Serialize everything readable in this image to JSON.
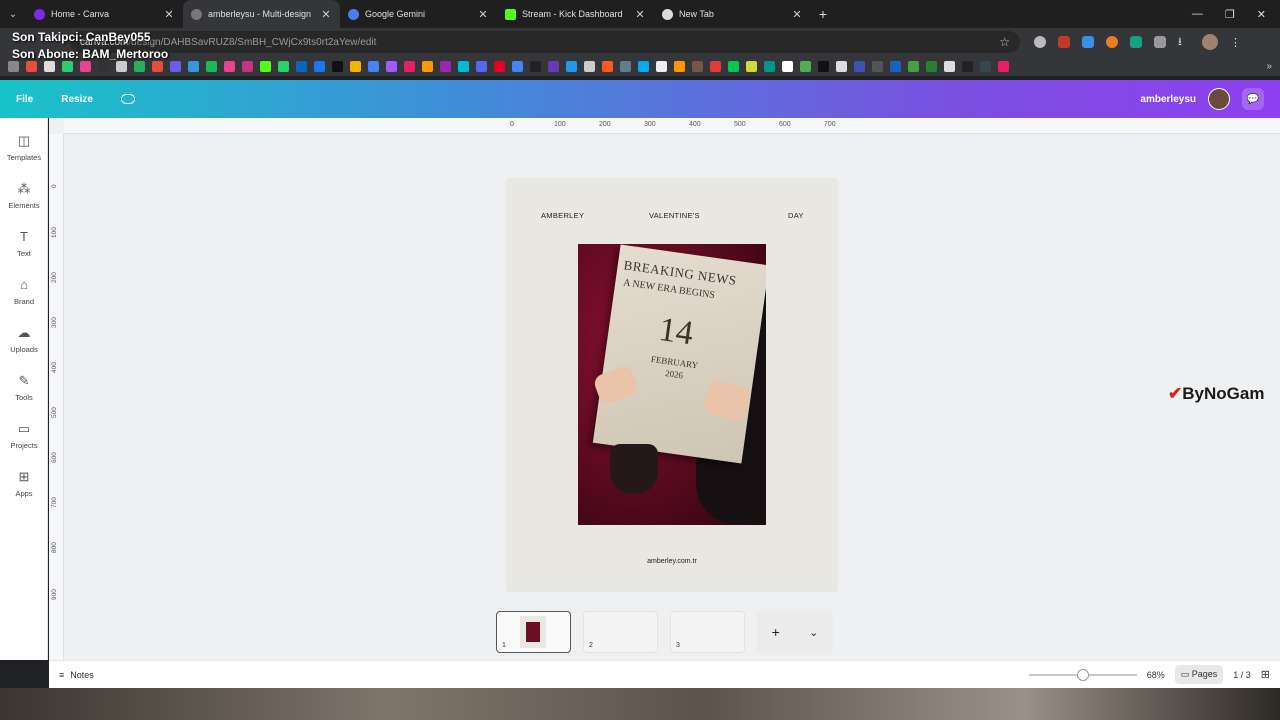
{
  "browser": {
    "tabs": [
      {
        "title": "Home - Canva",
        "favicon_color": "#7d2ae8"
      },
      {
        "title": "amberleysu - Multi-design",
        "favicon_color": "#555555",
        "active": true
      },
      {
        "title": "Google Gemini",
        "favicon_color": "#4d7bf3"
      },
      {
        "title": "Stream - Kick Dashboard",
        "favicon_color": "#53fc18"
      },
      {
        "title": "New Tab",
        "favicon_color": "#dddddd"
      }
    ],
    "url_host": "canva.com",
    "url_path": "/design/DAHBSavRUZ8/SmBH_CWjCx9ts0rt2aYew/edit"
  },
  "overlay": {
    "line1": "Son Takipci: CanBey055",
    "line2": "Son Abone: BAM_Mertoroo"
  },
  "header": {
    "file_label": "File",
    "resize_label": "Resize",
    "user_name": "amberleysu"
  },
  "sidebar": {
    "items": [
      {
        "label": "Templates",
        "icon": "templates-icon"
      },
      {
        "label": "Elements",
        "icon": "elements-icon"
      },
      {
        "label": "Text",
        "icon": "text-icon"
      },
      {
        "label": "Brand",
        "icon": "brand-icon"
      },
      {
        "label": "Uploads",
        "icon": "uploads-icon"
      },
      {
        "label": "Tools",
        "icon": "tools-icon"
      },
      {
        "label": "Projects",
        "icon": "projects-icon"
      },
      {
        "label": "Apps",
        "icon": "apps-icon"
      }
    ]
  },
  "rulers": {
    "top": [
      "0",
      "100",
      "200",
      "300",
      "400",
      "500",
      "600",
      "700"
    ],
    "left": [
      "0",
      "100",
      "200",
      "300",
      "400",
      "500",
      "600",
      "700",
      "800",
      "900"
    ]
  },
  "design": {
    "header_left": "AMBERLEY",
    "header_center": "VALENTINE'S",
    "header_right": "DAY",
    "paper_headline1": "BREAKING NEWS",
    "paper_headline2": "A NEW ERA BEGINS",
    "paper_day": "14",
    "paper_month": "FEBRUARY",
    "paper_year": "2026",
    "footer": "amberley.com.tr"
  },
  "pages": {
    "thumbs": [
      "1",
      "2",
      "3"
    ],
    "add_label": "+",
    "chevron": "⌄"
  },
  "footer": {
    "notes_label": "Notes",
    "zoom": "68%",
    "pages_label": "Pages",
    "page_count": "1 / 3"
  },
  "watermark": {
    "text": "ByNoGam"
  }
}
